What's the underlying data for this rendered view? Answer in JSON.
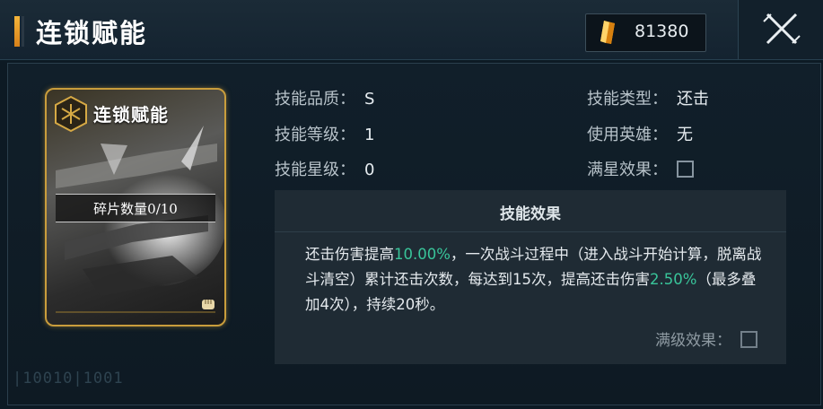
{
  "header": {
    "title": "连锁赋能",
    "currency_icon": "crystal-icon",
    "currency_value": "81380",
    "close_icon": "close-icon"
  },
  "card": {
    "name": "连锁赋能",
    "fragments_label": "碎片数量0/10",
    "emblem_icon": "hexagon-emblem-icon",
    "corner_icon": "fist-icon"
  },
  "info": {
    "quality_label": "技能品质：",
    "quality_value": "S",
    "level_label": "技能等级：",
    "level_value": "1",
    "star_label": "技能星级：",
    "star_value": "0",
    "type_label": "技能类型：",
    "type_value": "还击",
    "hero_label": "使用英雄：",
    "hero_value": "无",
    "full_star_label": "满星效果："
  },
  "effect": {
    "title": "技能效果",
    "text_1": "还击伤害提高",
    "value_1": "10.00%",
    "text_2": "，一次战斗过程中（进入战斗开始计算，脱离战斗清空）累计还击次数，每达到15次，提高还击伤害",
    "value_2": "2.50%",
    "text_3": "（最多叠加4次），持续20秒。",
    "max_level_label": "满级效果："
  },
  "footer": {
    "watermark": "|10010|1001"
  },
  "colors": {
    "accent_gold": "#c99d3c",
    "highlight_green": "#39c59a",
    "background": "#0d1a24"
  }
}
